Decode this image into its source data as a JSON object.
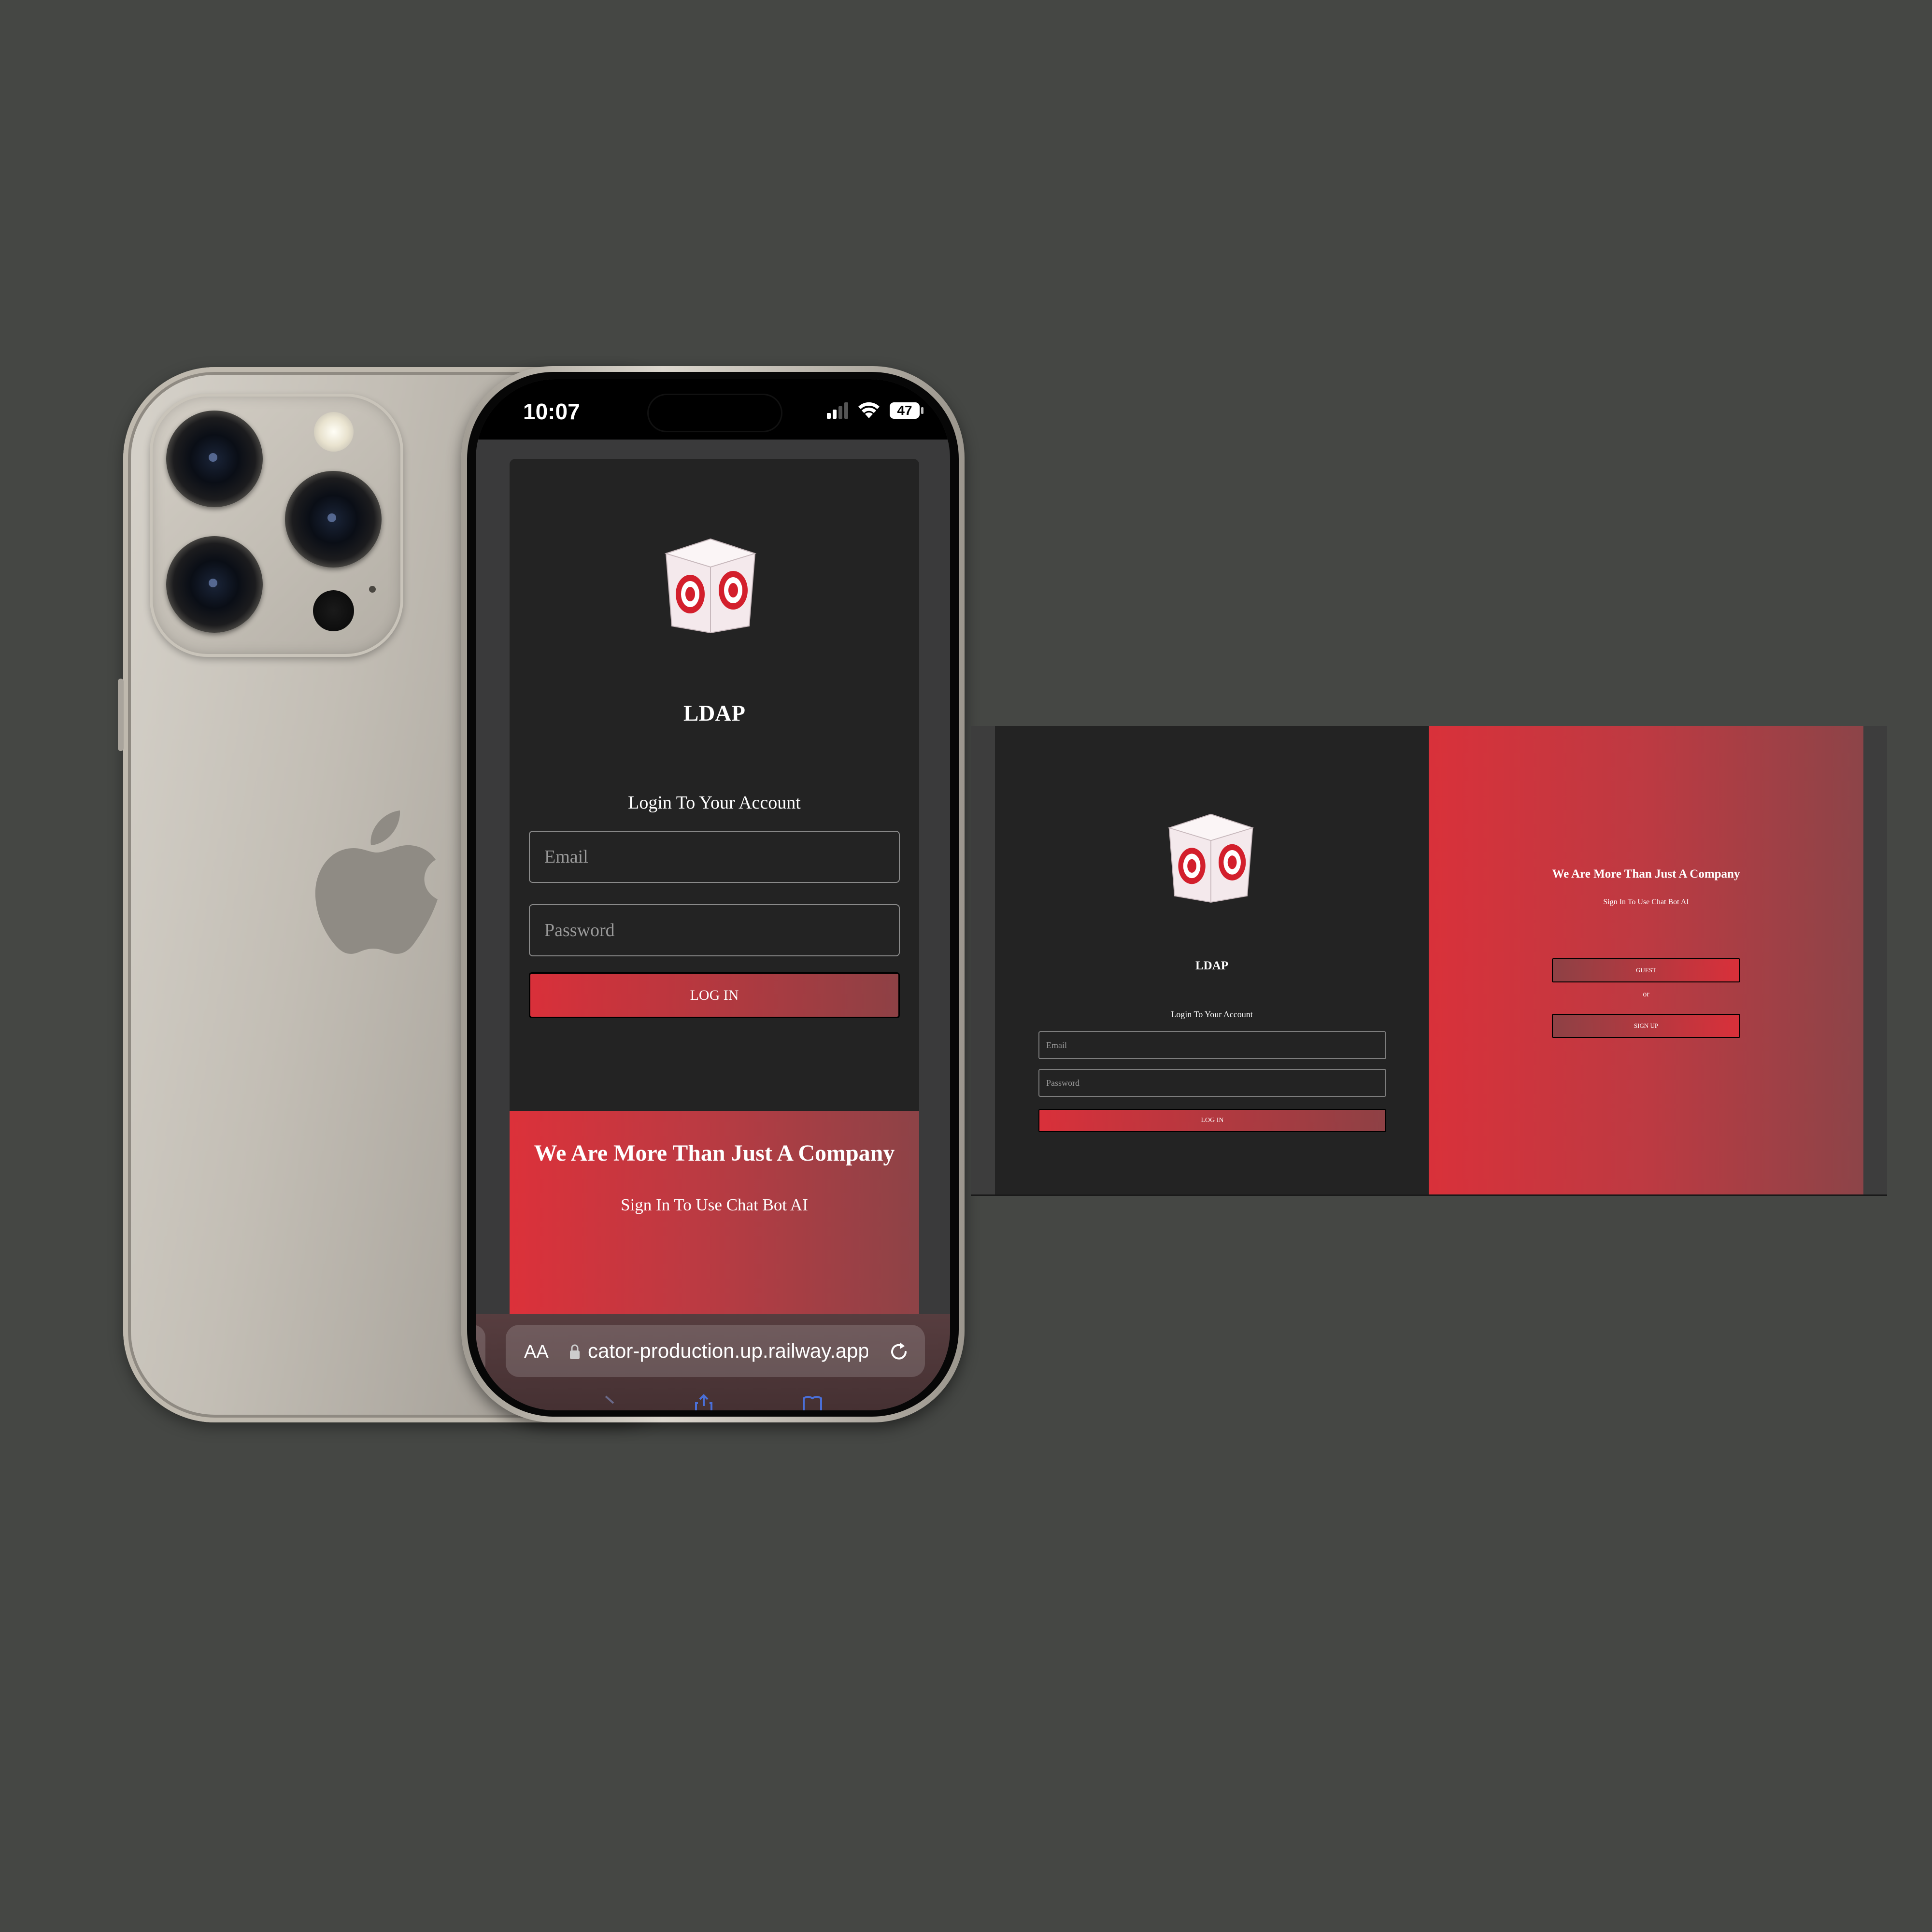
{
  "mobile": {
    "status_bar": {
      "time": "10:07",
      "battery": "47"
    },
    "brand": "LDAP",
    "login_heading": "Login To Your Account",
    "email_placeholder": "Email",
    "password_placeholder": "Password",
    "login_button": "LOG IN",
    "promo_title": "We Are More Than Just A Company",
    "promo_subtitle": "Sign In To Use Chat Bot AI",
    "safari": {
      "text_size_button": "AA",
      "url": "cator-production.up.railway.app"
    }
  },
  "desktop": {
    "brand": "LDAP",
    "login_heading": "Login To Your Account",
    "email_placeholder": "Email",
    "password_placeholder": "Password",
    "login_button": "LOG IN",
    "promo_title": "We Are More Than Just A Company",
    "promo_subtitle": "Sign In To Use Chat Bot AI",
    "guest_button": "GUEST",
    "or_text": "or",
    "signup_button": "SIGN UP"
  },
  "colors": {
    "background": "#454744",
    "panel": "#232323",
    "accent_red": "#d9303a",
    "accent_dark_red": "#8e4145"
  },
  "icons": [
    "logo-box-icon",
    "signal-icon",
    "wifi-icon",
    "battery-icon",
    "lock-icon",
    "reload-icon",
    "apple-logo"
  ]
}
